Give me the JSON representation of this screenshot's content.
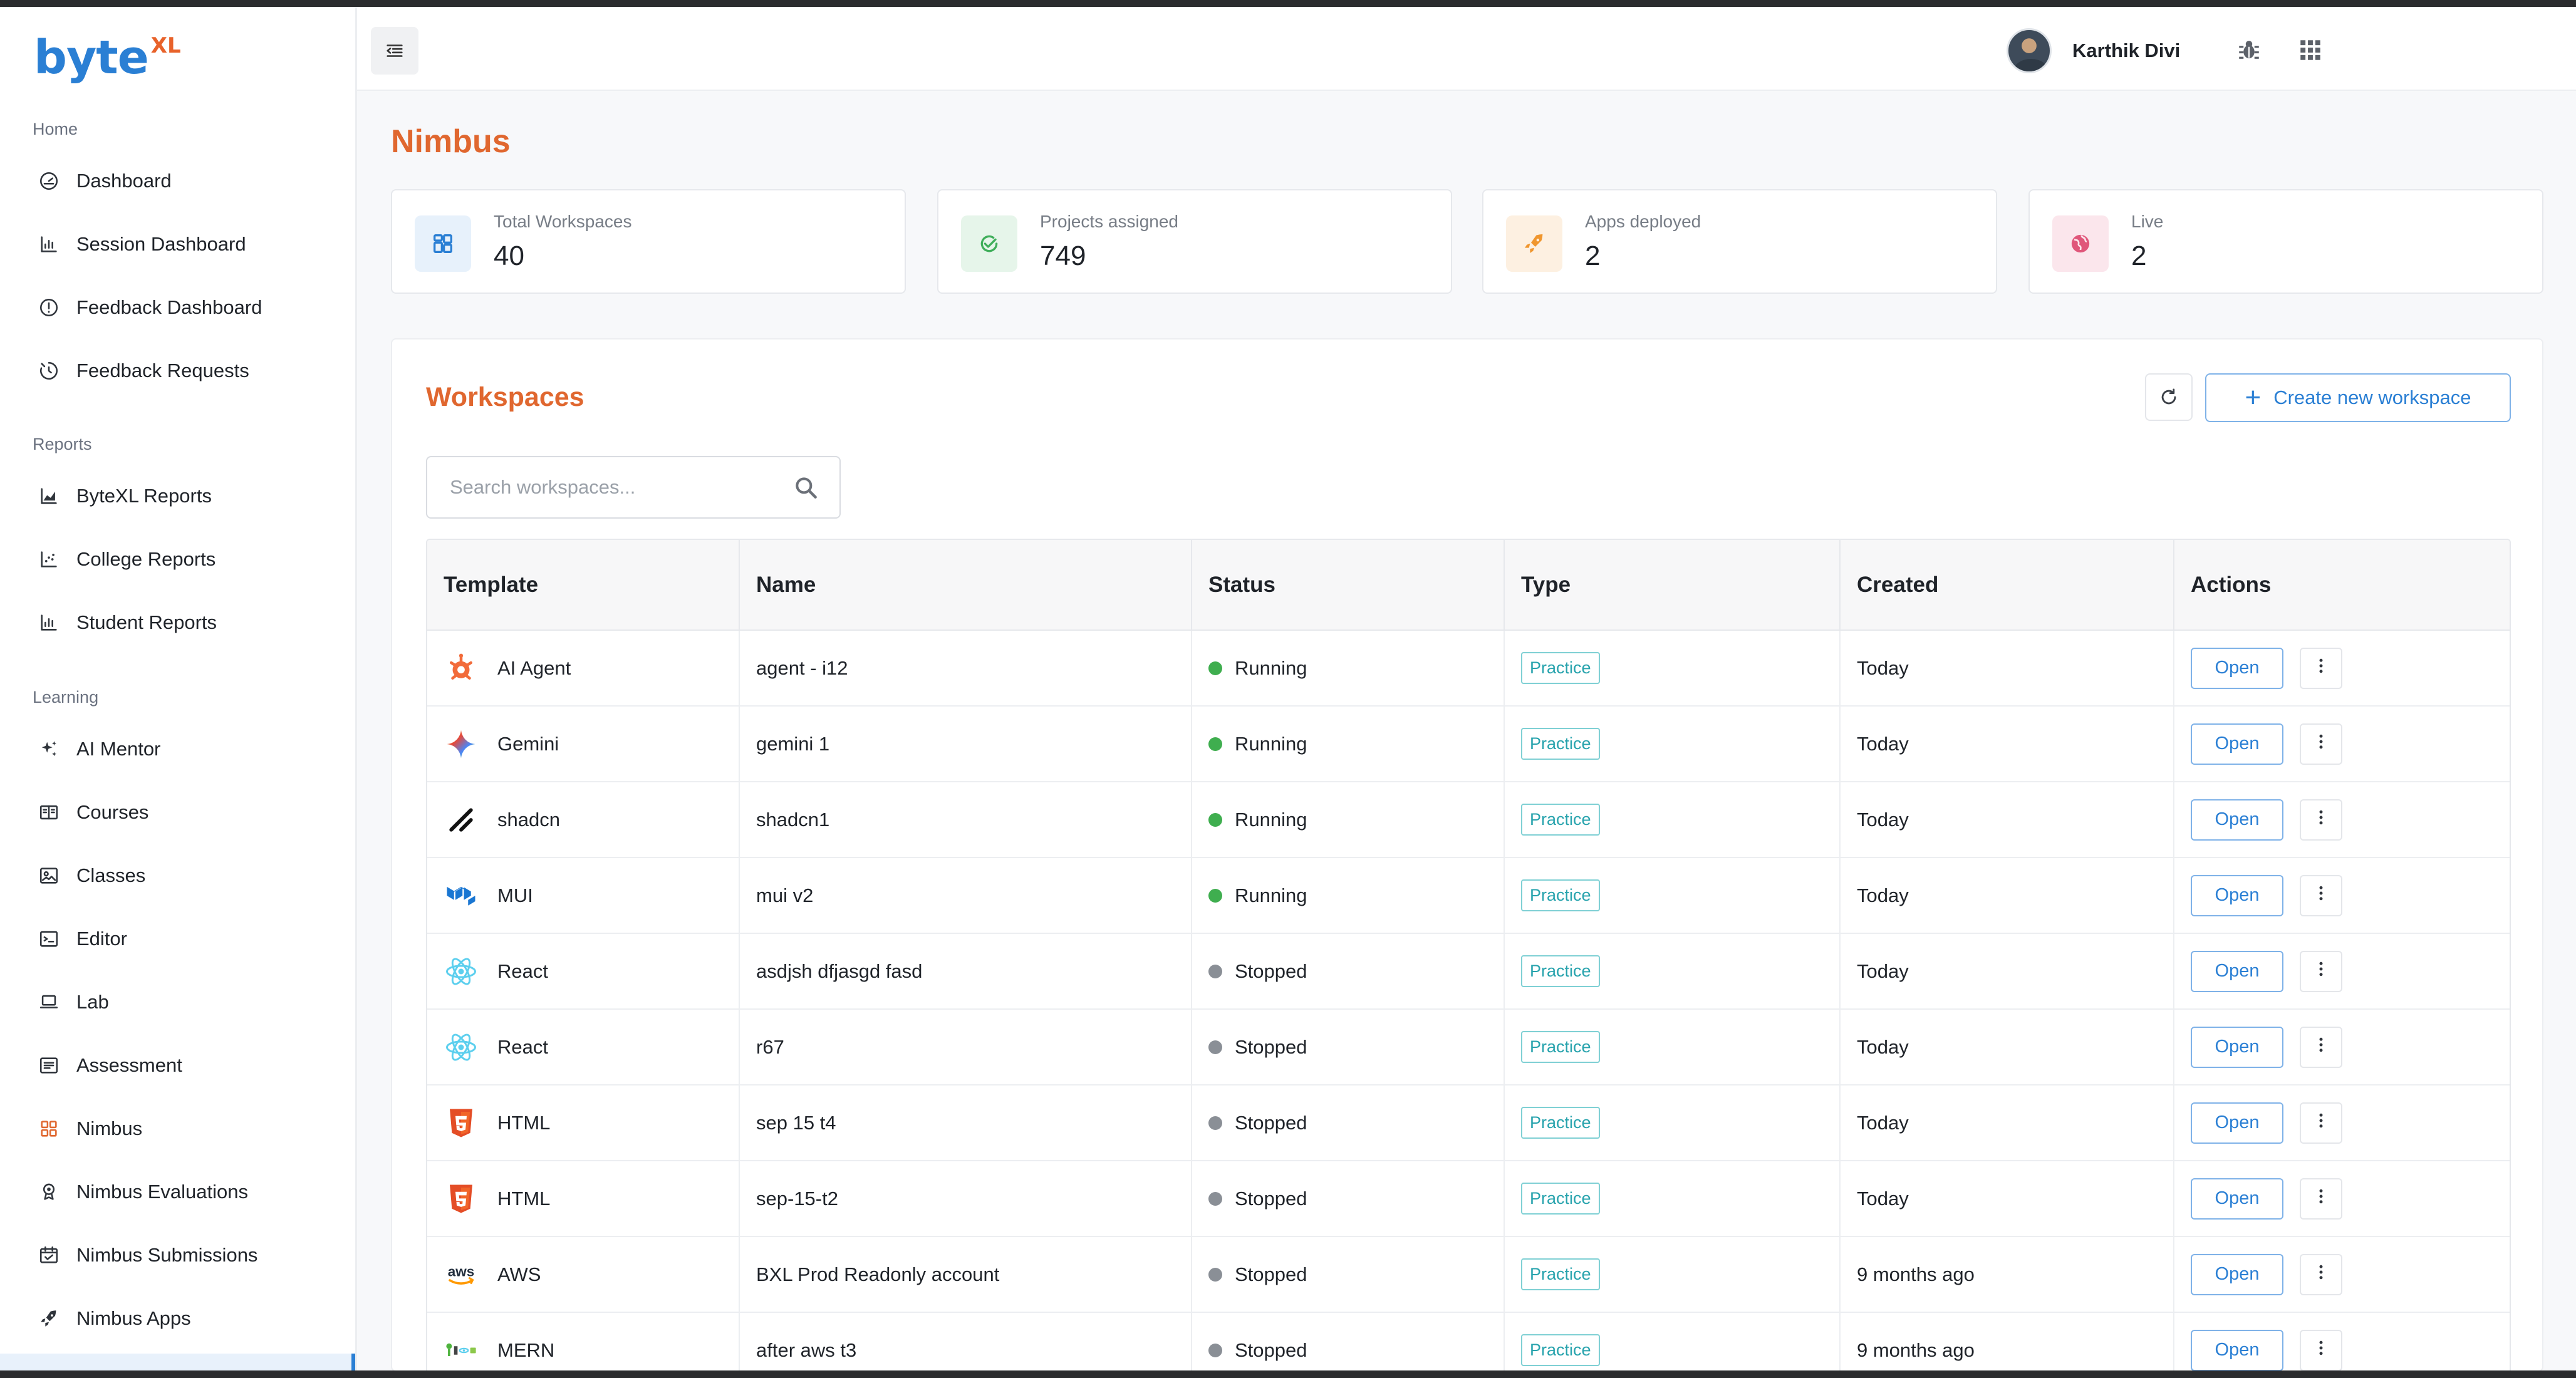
{
  "brand": {
    "name": "byte",
    "superscript": "XL"
  },
  "sidebar": {
    "sections": [
      {
        "label": "Home",
        "items": [
          {
            "label": "Dashboard",
            "icon": "gauge-icon"
          },
          {
            "label": "Session Dashboard",
            "icon": "bar-chart-icon"
          },
          {
            "label": "Feedback Dashboard",
            "icon": "alert-circle-icon"
          },
          {
            "label": "Feedback Requests",
            "icon": "timer-icon"
          }
        ]
      },
      {
        "label": "Reports",
        "items": [
          {
            "label": "ByteXL Reports",
            "icon": "area-chart-icon"
          },
          {
            "label": "College Reports",
            "icon": "scatter-chart-icon"
          },
          {
            "label": "Student Reports",
            "icon": "bar-chart-icon"
          }
        ]
      },
      {
        "label": "Learning",
        "items": [
          {
            "label": "AI Mentor",
            "icon": "sparkles-icon"
          },
          {
            "label": "Courses",
            "icon": "book-open-icon"
          },
          {
            "label": "Classes",
            "icon": "image-card-icon"
          },
          {
            "label": "Editor",
            "icon": "terminal-icon"
          },
          {
            "label": "Lab",
            "icon": "laptop-icon"
          },
          {
            "label": "Assessment",
            "icon": "list-box-icon"
          },
          {
            "label": "Nimbus",
            "icon": "grid-icon"
          },
          {
            "label": "Nimbus Evaluations",
            "icon": "award-icon"
          },
          {
            "label": "Nimbus Submissions",
            "icon": "calendar-check-icon"
          },
          {
            "label": "Nimbus Apps",
            "icon": "rocket-icon"
          }
        ]
      }
    ]
  },
  "header": {
    "user_name": "Karthik Divi",
    "icons": [
      "bug-icon",
      "apps-grid-icon"
    ]
  },
  "page": {
    "title": "Nimbus"
  },
  "stats": [
    {
      "label": "Total Workspaces",
      "value": "40",
      "icon": "workspaces-icon",
      "color": "#2a7fd4",
      "bg": "#e7f1fb"
    },
    {
      "label": "Projects assigned",
      "value": "749",
      "icon": "check-circle-icon",
      "color": "#3fae5a",
      "bg": "#e6f5ea"
    },
    {
      "label": "Apps deployed",
      "value": "2",
      "icon": "rocket-icon",
      "color": "#f0962e",
      "bg": "#fdf0e1"
    },
    {
      "label": "Live",
      "value": "2",
      "icon": "globe-icon",
      "color": "#e0567a",
      "bg": "#fbe6ec"
    }
  ],
  "workspaces": {
    "title": "Workspaces",
    "create_label": "Create new workspace",
    "search_placeholder": "Search workspaces...",
    "columns": [
      "Template",
      "Name",
      "Status",
      "Type",
      "Created",
      "Actions"
    ],
    "open_label": "Open",
    "rows": [
      {
        "template": "AI Agent",
        "icon": "ai-agent-icon",
        "name": "agent - i12",
        "status": "Running",
        "type": "Practice",
        "created": "Today"
      },
      {
        "template": "Gemini",
        "icon": "gemini-icon",
        "name": "gemini 1",
        "status": "Running",
        "type": "Practice",
        "created": "Today"
      },
      {
        "template": "shadcn",
        "icon": "shadcn-icon",
        "name": "shadcn1",
        "status": "Running",
        "type": "Practice",
        "created": "Today"
      },
      {
        "template": "MUI",
        "icon": "mui-icon",
        "name": "mui v2",
        "status": "Running",
        "type": "Practice",
        "created": "Today"
      },
      {
        "template": "React",
        "icon": "react-icon",
        "name": "asdjsh dfjasgd fasd",
        "status": "Stopped",
        "type": "Practice",
        "created": "Today"
      },
      {
        "template": "React",
        "icon": "react-icon",
        "name": "r67",
        "status": "Stopped",
        "type": "Practice",
        "created": "Today"
      },
      {
        "template": "HTML",
        "icon": "html5-icon",
        "name": "sep 15 t4",
        "status": "Stopped",
        "type": "Practice",
        "created": "Today"
      },
      {
        "template": "HTML",
        "icon": "html5-icon",
        "name": "sep-15-t2",
        "status": "Stopped",
        "type": "Practice",
        "created": "Today"
      },
      {
        "template": "AWS",
        "icon": "aws-icon",
        "name": "BXL Prod Readonly account",
        "status": "Stopped",
        "type": "Practice",
        "created": "9 months ago"
      },
      {
        "template": "MERN",
        "icon": "mern-icon",
        "name": "after aws t3",
        "status": "Stopped",
        "type": "Practice",
        "created": "9 months ago"
      }
    ],
    "status_colors": {
      "Running": "#3fae4f",
      "Stopped": "#8a8f96"
    }
  },
  "colors": {
    "accent": "#e0672f",
    "primary": "#2a7fd4"
  }
}
